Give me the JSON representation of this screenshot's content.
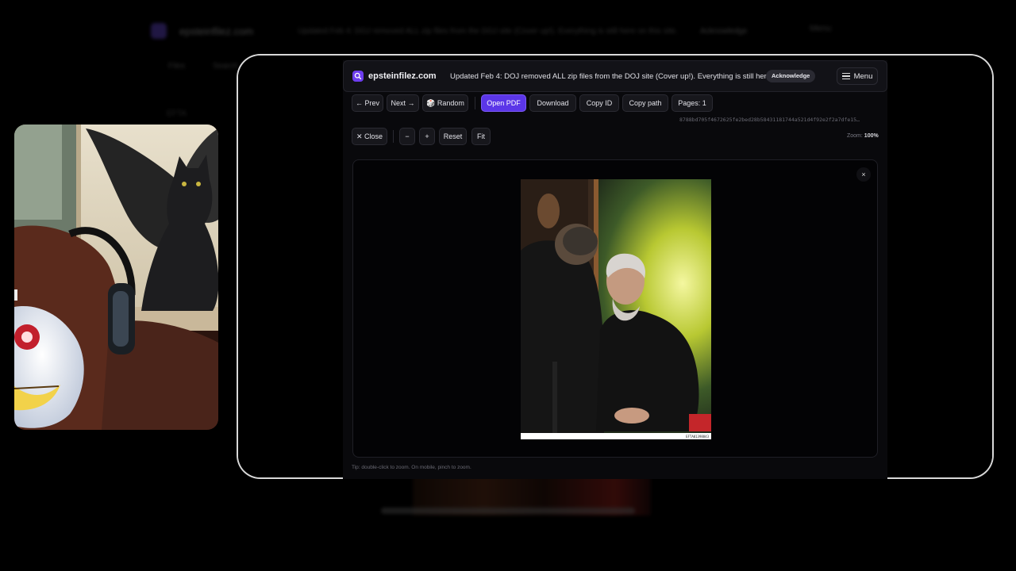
{
  "background": {
    "brand": "epsteinfilez.com",
    "notice": "Updated Feb 4: DOJ removed ALL zip files from the DOJ site (Cover up!). Everything is still here on this site.",
    "ack": "Acknowledge",
    "menu": "Menu",
    "nav_1": "Files",
    "nav_2": "Search",
    "line": "EFTA"
  },
  "header": {
    "brand": "epsteinfilez.com",
    "notice": "Updated Feb 4: DOJ removed ALL zip files from the DOJ site (Cover up!). Everything is still here on this site.",
    "ack_label": "Acknowledge",
    "menu_label": "Menu"
  },
  "toolbar": {
    "prev": "← Prev",
    "next": "Next →",
    "random": "🎲 Random",
    "open_pdf": "Open PDF",
    "download": "Download",
    "copy_id": "Copy ID",
    "copy_path": "Copy path",
    "pages": "Pages: 1",
    "hash": "8788bd705f4672625fe2bed28b58431181744a521d4f92e2f2a7dfe15…"
  },
  "zoombar": {
    "close": "✕ Close",
    "minus": "−",
    "plus": "+",
    "reset": "Reset",
    "fit": "Fit",
    "zoom_label": "Zoom:",
    "zoom_value": "100%"
  },
  "viewer": {
    "close_icon": "×",
    "photo_id": "EFTA01398843",
    "tip": "Tip: double-click to zoom. On mobile, pinch to zoom."
  },
  "colors": {
    "accent": "#5b36e8",
    "panel": "#09090c"
  }
}
